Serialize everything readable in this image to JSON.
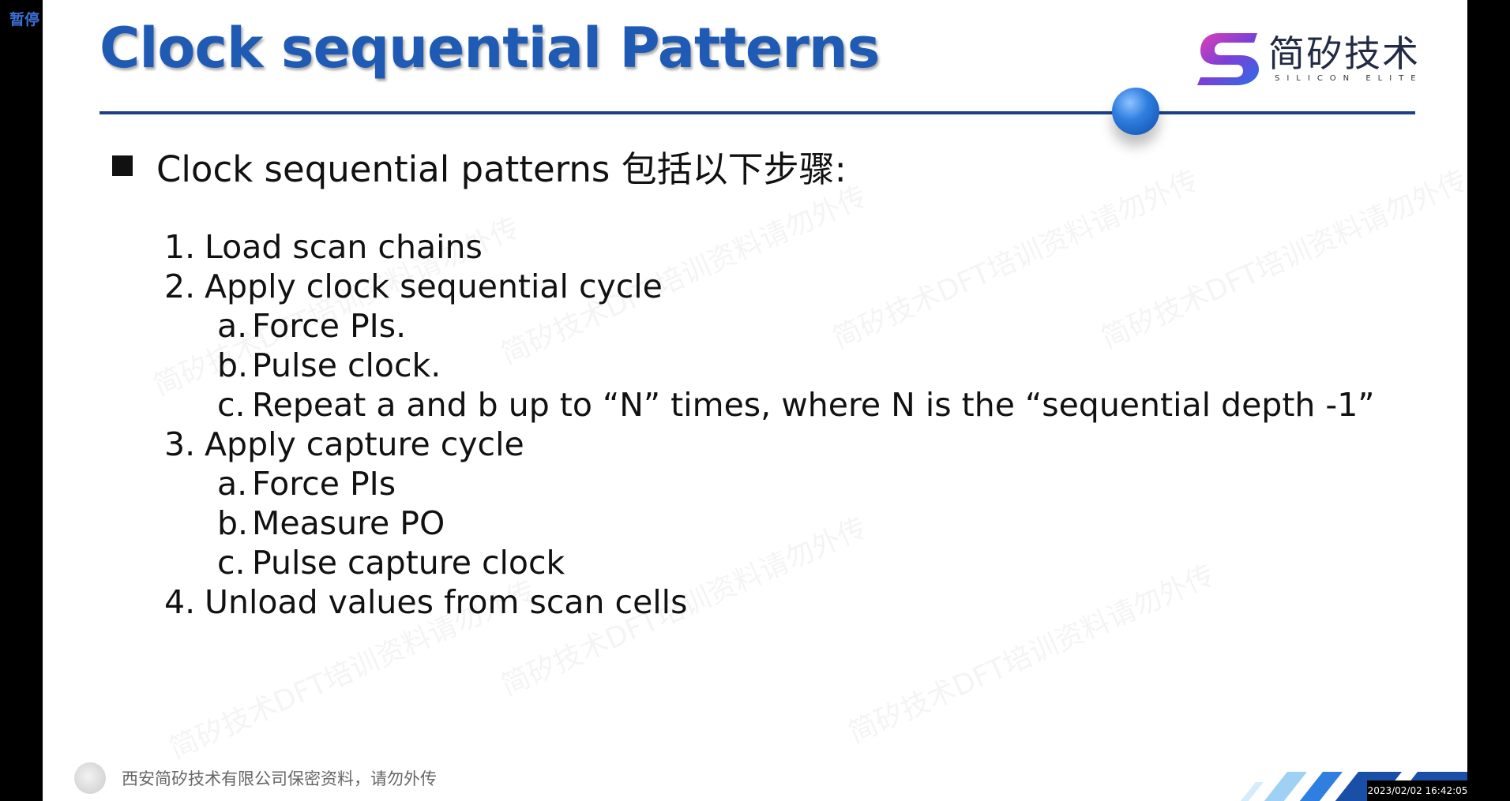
{
  "overlay": {
    "pause_label": "暂停",
    "timestamp": "2023/02/02 16:42:05"
  },
  "slide": {
    "title": "Clock sequential Patterns",
    "logo": {
      "chinese_name": "简矽技术",
      "english_name": "SILICON ELITE",
      "mark_colors": [
        "#e23fb4",
        "#7b3fd8",
        "#2a6fe6"
      ]
    },
    "accent_color": "#1f5bb4",
    "main_bullet": "Clock sequential patterns 包括以下步骤:",
    "steps": [
      {
        "num": "1.",
        "text": "Load scan chains",
        "subs": []
      },
      {
        "num": "2.",
        "text": "Apply clock sequential cycle",
        "subs": [
          {
            "num": "a.",
            "text": "Force PIs."
          },
          {
            "num": "b.",
            "text": "Pulse clock."
          },
          {
            "num": "c.",
            "text": "Repeat a and b up to “N” times, where N is the “sequential depth -1”"
          }
        ]
      },
      {
        "num": "3.",
        "text": "Apply capture cycle",
        "subs": [
          {
            "num": "a.",
            "text": "Force PIs"
          },
          {
            "num": "b.",
            "text": "Measure PO"
          },
          {
            "num": "c.",
            "text": "Pulse capture clock"
          }
        ]
      },
      {
        "num": "4.",
        "text": "Unload values from scan cells",
        "subs": []
      }
    ],
    "footer_text": "西安简矽技术有限公司保密资料，请勿外传",
    "watermark_text": "简矽技术DFT培训资料请勿外传"
  }
}
